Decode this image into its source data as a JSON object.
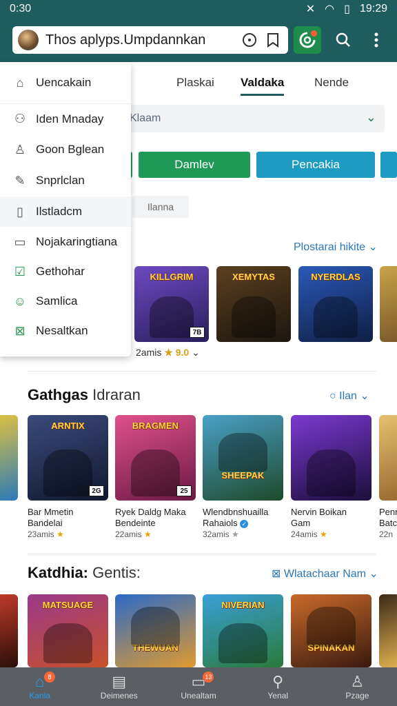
{
  "status": {
    "time_left": "0:30",
    "time_right": "19:29"
  },
  "appbar": {
    "url_text": "Thos aplyps.Umpdannkan",
    "colors": {
      "bar": "#1e5c5d",
      "extension": "#1e8c4b"
    }
  },
  "tabs": [
    {
      "label": "Plaskai"
    },
    {
      "label": "Valdaka"
    },
    {
      "label": "Nende"
    }
  ],
  "filter": {
    "select_value": "Klaam",
    "buttons": [
      {
        "label": "Damlev",
        "color": "#1e9a56"
      },
      {
        "label": "Pencakia",
        "color": "#1e9bc2"
      }
    ],
    "chip": "Ilanna"
  },
  "dropdown": {
    "items": [
      {
        "label": "Uencakain",
        "icon": "storefront-icon"
      },
      {
        "label": "Iden Mnaday",
        "icon": "handshake-icon"
      },
      {
        "label": "Goon Bglean",
        "icon": "person-icon"
      },
      {
        "label": "Snprlclan",
        "icon": "pencil-icon"
      },
      {
        "label": "Ilstladcm",
        "icon": "tablet-icon"
      },
      {
        "label": "Nojakaringtiana",
        "icon": "document-icon"
      },
      {
        "label": "Gethohar",
        "icon": "checkbox-icon"
      },
      {
        "label": "Samlica",
        "icon": "smiley-icon"
      },
      {
        "label": "Nesaltkan",
        "icon": "export-box-icon"
      }
    ]
  },
  "section1": {
    "link": "Plostarai hikite",
    "meta_text": "2amis",
    "meta_rating": "9.0",
    "thumbs": [
      {
        "title": "KILLGRIM",
        "badge": "7B",
        "color": "#4a3a8a"
      },
      {
        "title": "XEMYTAS",
        "badge": "",
        "color": "#3b2c1e"
      },
      {
        "title": "NYERDLAS",
        "badge": "",
        "color": "#1d3d7a"
      }
    ]
  },
  "section2": {
    "title_bold": "Gathgas",
    "title_sub": "Idraran",
    "link": "Ilan",
    "cards": [
      {
        "title": "Bar Mmetin",
        "subtitle": "Bandelai",
        "meta": "23amis",
        "badge": "2G",
        "color": "#2a3a5c",
        "thumb_title": "ARNTIX"
      },
      {
        "title": "Ryek Daldg Maka",
        "subtitle": "Bendeinte",
        "meta": "22amis",
        "badge": "25",
        "color": "#c53a6c",
        "thumb_title": "BRAGMEN"
      },
      {
        "title": "Wlendbnshuailla",
        "subtitle": "Rahaiols",
        "meta": "32amis",
        "badge": "",
        "color": "#2f6f8a",
        "thumb_title": "SHEEPAK"
      },
      {
        "title": "Nervin Boikan",
        "subtitle": "Gam",
        "meta": "24amis",
        "badge": "",
        "color": "#4a2a7a",
        "thumb_title": ""
      },
      {
        "title": "Penn",
        "subtitle": "Batc",
        "meta": "22n",
        "badge": "",
        "color": "#b88a3a",
        "thumb_title": ""
      }
    ]
  },
  "section3": {
    "title_bold": "Katdhia:",
    "title_sub": "Gentis:",
    "link": "Wlatachaar Nam",
    "thumbs": [
      {
        "title": "MATSUAGE",
        "color": "#7a2a1a"
      },
      {
        "title": "THEWUAN",
        "color": "#1e4a8a"
      },
      {
        "title": "NIVERIAN",
        "color": "#2a6a4a"
      },
      {
        "title": "SPINAKAN",
        "color": "#5a2a1a"
      }
    ]
  },
  "bottomnav": [
    {
      "label": "Kanla",
      "icon": "home-icon",
      "badge": "8",
      "active": true
    },
    {
      "label": "Deimenes",
      "icon": "calendar-icon",
      "badge": "",
      "active": false
    },
    {
      "label": "Unealtam",
      "icon": "inbox-icon",
      "badge": "13",
      "active": false
    },
    {
      "label": "Yenal",
      "icon": "search-icon",
      "badge": "",
      "active": false
    },
    {
      "label": "Pzage",
      "icon": "profile-icon",
      "badge": "",
      "active": false
    }
  ]
}
